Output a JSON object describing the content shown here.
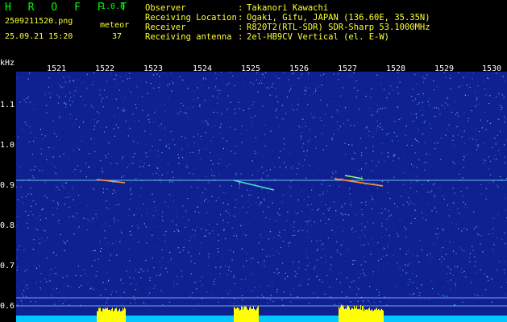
{
  "app": {
    "logo": "H R O F F T",
    "version": "1.0.0"
  },
  "capture": {
    "filename": "2509211520.png",
    "datetime": "25.09.21 15:20",
    "label": "meteor",
    "count": "37"
  },
  "info": [
    {
      "label": "Observer",
      "value": "Takanori Kawachi"
    },
    {
      "label": "Receiving Location",
      "value": "Ogaki, Gifu, JAPAN (136.60E, 35.35N)"
    },
    {
      "label": "Receiver",
      "value": "R820T2(RTL-SDR) SDR-Sharp 53.1000MHz"
    },
    {
      "label": "Receiving antenna",
      "value": "2el-HB9CV Vertical (el. E-W)"
    }
  ],
  "separator": ":",
  "axis": {
    "unit": "kHz",
    "x_ticks": [
      "1521",
      "1522",
      "1523",
      "1524",
      "1525",
      "1526",
      "1527",
      "1528",
      "1529",
      "1530"
    ],
    "y_ticks": [
      "1.1",
      "1.0",
      "0.9",
      "0.8",
      "0.7",
      "0.6"
    ]
  },
  "colors": {
    "background": "#0f2190",
    "logo": "#00ff00",
    "header_text": "#ffff33",
    "labels": "#ffffff",
    "trace": "#7fe8ff",
    "bottom_bar": "#ffff00",
    "bottom_base": "#00c8ff"
  }
}
